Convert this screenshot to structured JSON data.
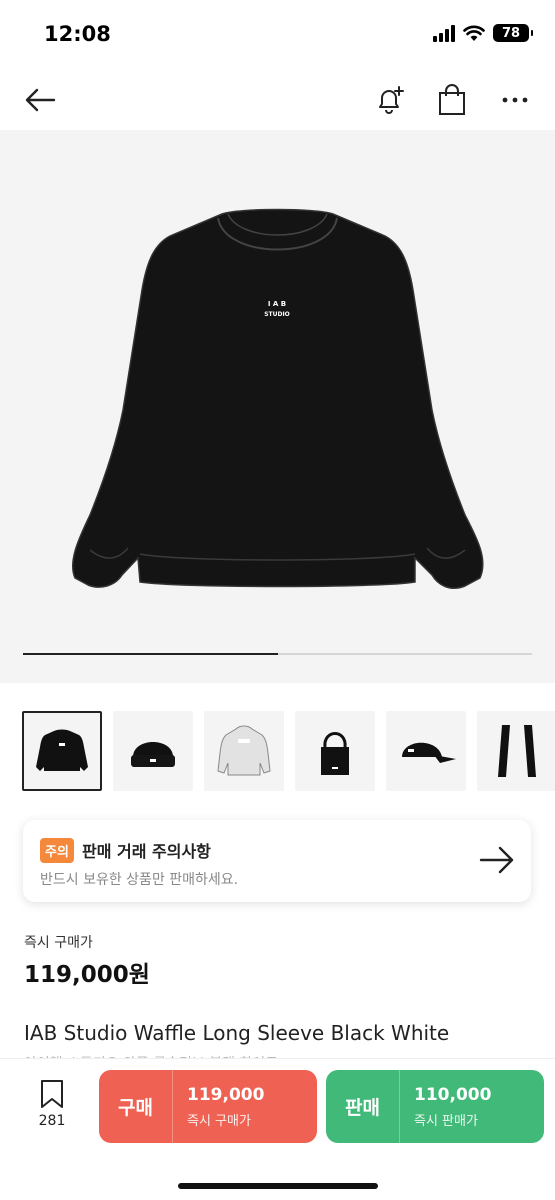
{
  "status_bar": {
    "time": "12:08",
    "battery": "78"
  },
  "hero": {
    "logo_line1": "I A B",
    "logo_line2": "STUDIO",
    "progress_fraction": 0.5
  },
  "thumbnails": [
    {
      "name": "thumb-sweatshirt"
    },
    {
      "name": "thumb-beanie"
    },
    {
      "name": "thumb-grey-jacket"
    },
    {
      "name": "thumb-tote-bag"
    },
    {
      "name": "thumb-cap"
    },
    {
      "name": "thumb-scarf"
    }
  ],
  "notice": {
    "badge": "주의",
    "title": "판매 거래 주의사항",
    "subtitle": "반드시 보유한 상품만 판매하세요."
  },
  "price": {
    "label": "즉시 구매가",
    "value": "119,000원"
  },
  "product": {
    "name": "IAB Studio Waffle Long Sleeve Black White",
    "subtitle": "아이앱 스튜디오 와플 롱슬리브 블랙 화이트"
  },
  "bottom_bar": {
    "wishlist_count": "281",
    "buy": {
      "label": "구매",
      "price": "119,000",
      "sub": "즉시 구매가",
      "color": "#ef6253"
    },
    "sell": {
      "label": "판매",
      "price": "110,000",
      "sub": "즉시 판매가",
      "color": "#41b979"
    }
  }
}
